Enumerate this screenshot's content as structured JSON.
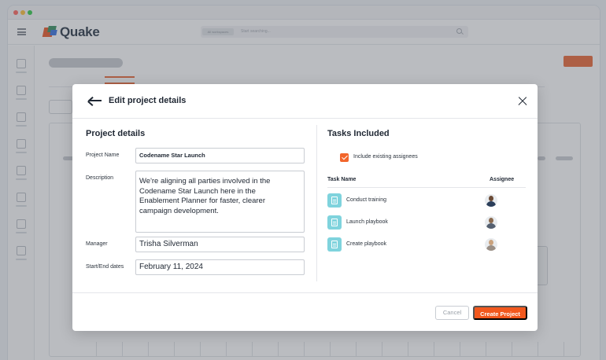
{
  "brand": {
    "name": "Quake"
  },
  "search": {
    "chip": "All workspaces",
    "placeholder": "Start searching..."
  },
  "modal": {
    "title": "Edit project details",
    "left_section_title": "Project details",
    "fields": {
      "project_name_label": "Project Name",
      "project_name_value": "Codename Star Launch",
      "description_label": "Description",
      "description_value": "We're aligning all parties involved in the\nCodename Star Launch here in the\nEnablement Planner for faster, clearer\ncampaign development.",
      "manager_label": "Manager",
      "manager_value": "Trisha Silverman",
      "dates_label": "Start/End dates",
      "dates_value": "February 11, 2024"
    },
    "right_section_title": "Tasks Included",
    "include_assignees_label": "Include existing assignees",
    "include_assignees_checked": true,
    "table_headers": {
      "task_name": "Task Name",
      "assignee": "Assignee"
    },
    "tasks": [
      {
        "name": "Conduct training"
      },
      {
        "name": "Launch playbook"
      },
      {
        "name": "Create playbook"
      }
    ],
    "buttons": {
      "cancel": "Cancel",
      "create": "Create Project"
    }
  },
  "colors": {
    "accent": "#f2581d",
    "task_icon": "#7fd3dd",
    "brand_red": "#e94e1b"
  }
}
